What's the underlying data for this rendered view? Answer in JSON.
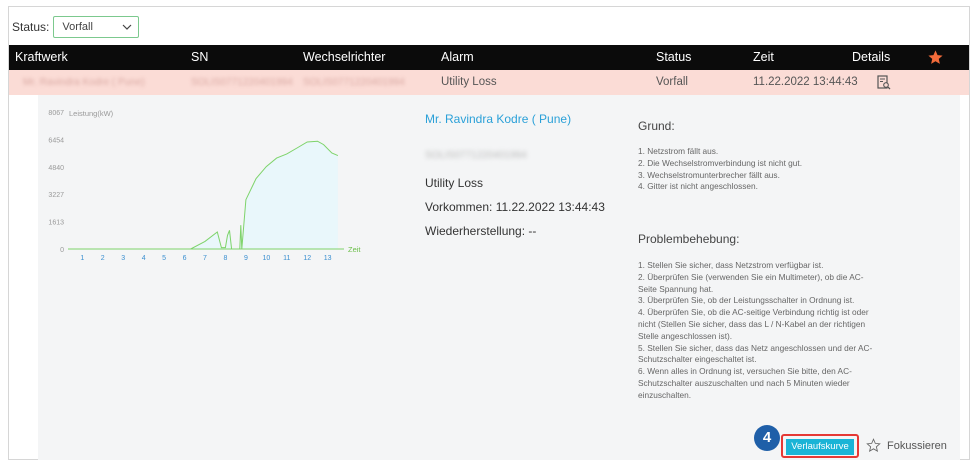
{
  "filter": {
    "label": "Status:",
    "value": "Vorfall"
  },
  "table": {
    "headers": {
      "plant": "Kraftwerk",
      "sn": "SN",
      "inverter": "Wechselrichter",
      "alarm": "Alarm",
      "status": "Status",
      "time": "Zeit",
      "details": "Details"
    },
    "row": {
      "plant": "Mr. Ravindra Kodre ( Pune)",
      "sn": "SOLIS0771220401994",
      "inverter": "SOLIS0771220401994",
      "alarm": "Utility Loss",
      "status": "Vorfall",
      "time": "11.22.2022 13:44:43"
    }
  },
  "chart_data": {
    "type": "area",
    "ylabel": "Leistung(kW)",
    "xlabel": "Zeit",
    "ylim": [
      0,
      8067
    ],
    "y_ticks": [
      "8067",
      "6454",
      "4840",
      "3227",
      "1613",
      "0"
    ],
    "x_ticks": [
      "1",
      "2",
      "3",
      "4",
      "5",
      "6",
      "7",
      "8",
      "9",
      "10",
      "11",
      "12",
      "13"
    ],
    "series": [
      {
        "x": [
          0.5,
          6.3,
          7.0,
          7.6,
          7.8,
          8.0,
          8.1,
          8.2,
          8.3,
          8.35,
          8.7,
          8.75,
          8.8,
          9.0,
          9.5,
          10.0,
          10.5,
          11.0,
          11.5,
          12.0,
          12.5,
          12.8,
          13.2,
          13.5
        ],
        "y": [
          0,
          0,
          450,
          1000,
          80,
          80,
          800,
          1100,
          0,
          0,
          0,
          1400,
          0,
          2900,
          4150,
          4850,
          5350,
          5600,
          5950,
          6300,
          6350,
          6150,
          5650,
          5500
        ]
      }
    ]
  },
  "info": {
    "plant_link": "Mr. Ravindra Kodre ( Pune)",
    "sn": "SOLIS0771220401994",
    "alarm": "Utility Loss",
    "occurred": "Vorkommen: 11.22.2022 13:44:43",
    "recovered": "Wiederherstellung: --"
  },
  "cause": {
    "title": "Grund:",
    "items": [
      "1. Netzstrom fällt aus.",
      "2. Die Wechselstromverbindung ist nicht gut.",
      "3. Wechselstromunterbrecher fällt aus.",
      "4. Gitter ist nicht angeschlossen."
    ]
  },
  "troubleshoot": {
    "title": "Problembehebung:",
    "lines": [
      "1. Stellen Sie sicher, dass Netzstrom verfügbar ist.",
      "2. Überprüfen Sie (verwenden Sie ein Multimeter), ob die AC-",
      "Seite Spannung hat.",
      "3. Überprüfen Sie, ob der Leistungsschalter in Ordnung ist.",
      "4. Überprüfen Sie, ob die AC-seitige Verbindung richtig ist oder",
      "nicht (Stellen Sie sicher, dass das L / N-Kabel an der richtigen",
      "Stelle angeschlossen ist).",
      "5. Stellen Sie sicher, dass das Netz angeschlossen und der AC-",
      "Schutzschalter eingeschaltet ist.",
      "6. Wenn alles in Ordnung ist, versuchen Sie bitte, den AC-",
      "Schutzschalter auszuschalten und nach 5 Minuten wieder",
      "einzuschalten."
    ]
  },
  "actions": {
    "step_badge": "4",
    "history_button": "Verlaufskurve",
    "focus_button": "Fokussieren"
  },
  "colors": {
    "accent": "#1ab4d6",
    "header_bg": "#0b0b0b",
    "row_bg": "#fbdcd6",
    "star": "#f26b3a",
    "chart_line": "#7ed36a",
    "highlight": "#e53935",
    "badge": "#1f5fa8",
    "link": "#2aa0d8"
  },
  "icons": {
    "star": "star-icon",
    "details": "document-search-icon",
    "dropdown": "chevron-down-icon",
    "focus": "star-outline-icon"
  }
}
